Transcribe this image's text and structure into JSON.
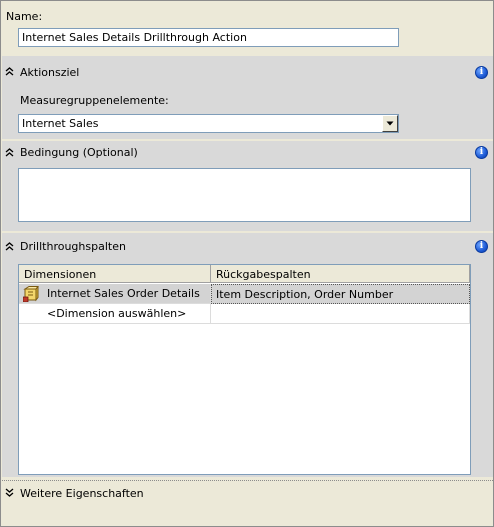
{
  "name": {
    "label": "Name:",
    "value": "Internet Sales Details Drillthrough Action"
  },
  "action_target": {
    "title": "Aktionsziel",
    "field_label": "Measuregruppenelemente:",
    "selected": "Internet Sales"
  },
  "condition": {
    "title": "Bedingung (Optional)",
    "value": ""
  },
  "drillthrough": {
    "title": "Drillthroughspalten",
    "columns": [
      "Dimensionen",
      "Rückgabespalten"
    ],
    "rows": [
      {
        "dimension": "Internet Sales Order Details",
        "columns": "Item Description, Order Number"
      },
      {
        "dimension": "<Dimension auswählen>",
        "columns": ""
      }
    ]
  },
  "more_properties": {
    "title": "Weitere Eigenschaften"
  },
  "colors": {
    "section_band": "#d9d9d9",
    "info_blue": "#1e5bd6",
    "selected_row": "#d3d3d3"
  }
}
